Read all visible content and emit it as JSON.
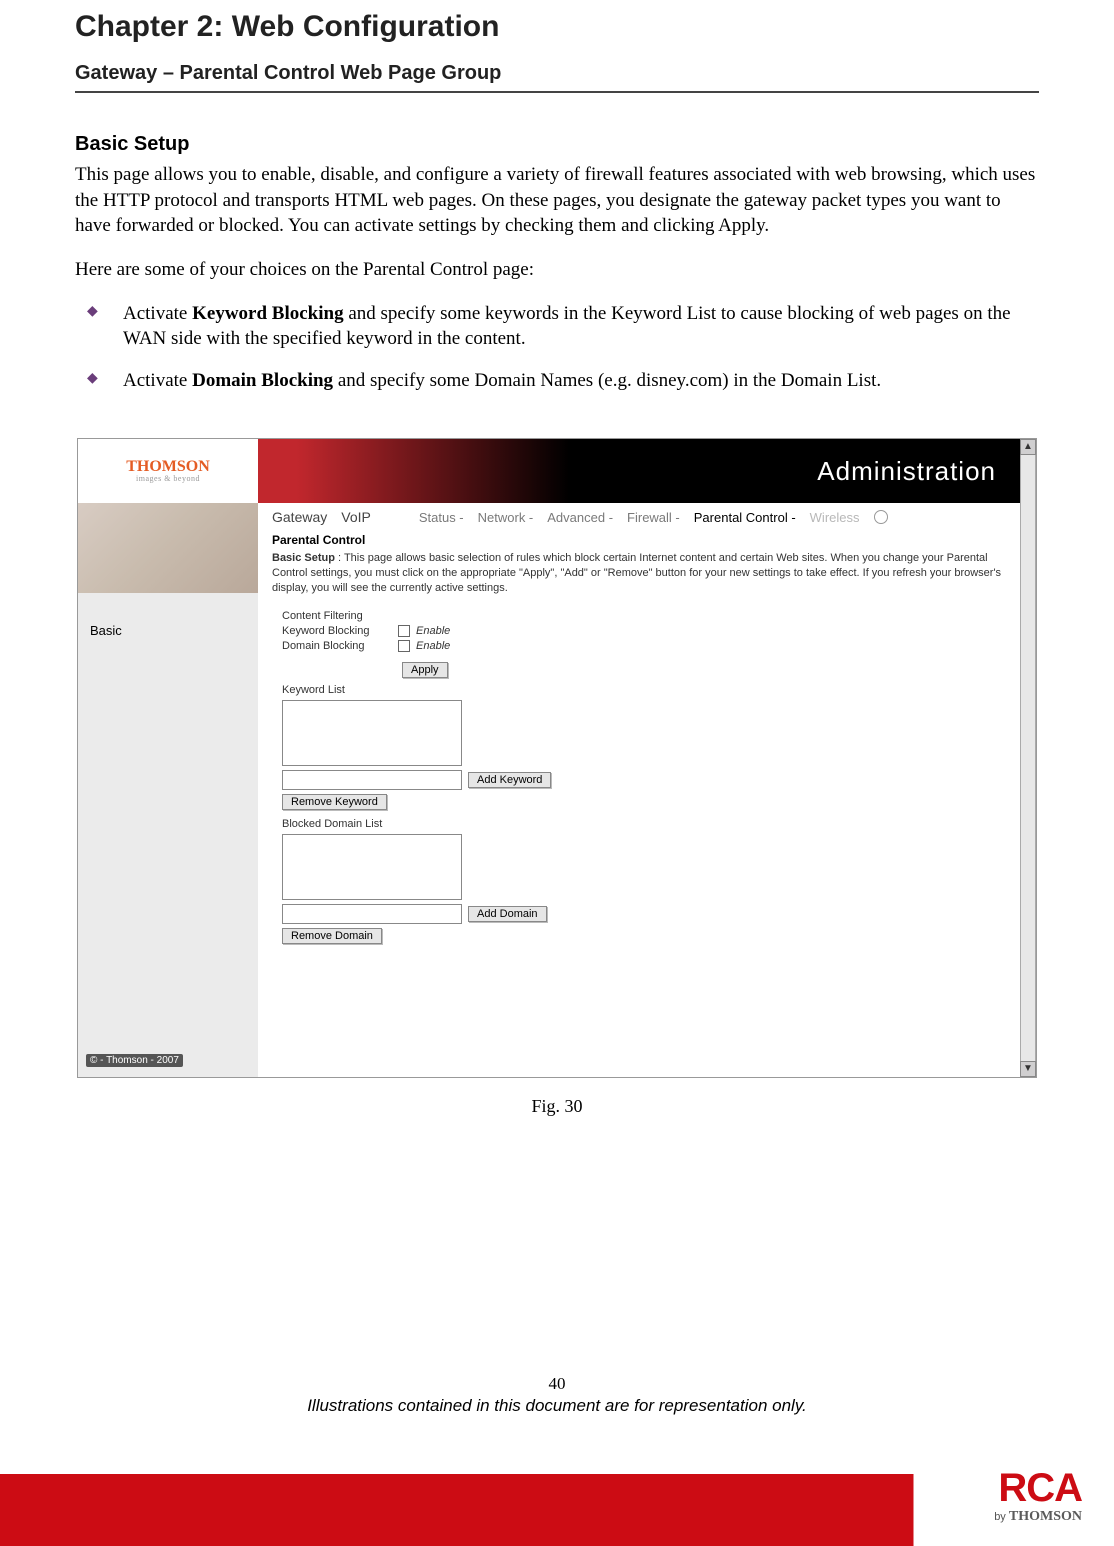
{
  "header": {
    "chapter": "Chapter 2: Web Configuration",
    "section": "Gateway – Parental Control Web Page Group"
  },
  "body": {
    "subhead": "Basic Setup",
    "p1": "This page allows you to enable, disable, and configure a variety of firewall features associated with web browsing, which uses the HTTP protocol and transports HTML web pages. On these pages, you designate the gateway packet types you want to have forwarded or blocked. You can activate settings by checking them and clicking Apply.",
    "p2": "Here are some of your choices on the Parental Control page:",
    "bullet1_pre": "Activate ",
    "bullet1_bold": "Keyword Blocking",
    "bullet1_post": " and specify some keywords in the Keyword List to cause blocking of web pages on the WAN side with the specified keyword in the content.",
    "bullet2_pre": "Activate ",
    "bullet2_bold": "Domain Blocking",
    "bullet2_post": " and specify some Domain Names (e.g. disney.com) in the Domain List."
  },
  "screenshot": {
    "brand": "THOMSON",
    "brand_tag": "images & beyond",
    "banner": "Administration",
    "sidebar_item": "Basic",
    "sidebar_copy": "© - Thomson - 2007",
    "tabs_primary": {
      "gateway": "Gateway",
      "voip": "VoIP"
    },
    "tabs_secondary": {
      "status": "Status -",
      "network": "Network -",
      "advanced": "Advanced -",
      "firewall": "Firewall -",
      "parental": "Parental Control -",
      "wireless": "Wireless"
    },
    "pc_title": "Parental Control",
    "basic_label": "Basic Setup",
    "basic_sep": " : ",
    "basic_desc": "This page allows basic selection of rules which block certain Internet content and certain Web sites. When you change your Parental Control settings, you must click on the appropriate \"Apply\", \"Add\" or \"Remove\" button for your new settings to take effect. If you refresh your browser's display, you will see the currently active settings.",
    "content_filtering": "Content Filtering",
    "keyword_blocking": "Keyword Blocking",
    "domain_blocking": "Domain Blocking",
    "enable": "Enable",
    "apply": "Apply",
    "keyword_list": "Keyword List",
    "add_keyword": "Add Keyword",
    "remove_keyword": "Remove Keyword",
    "blocked_domain_list": "Blocked Domain List",
    "add_domain": "Add Domain",
    "remove_domain": "Remove Domain"
  },
  "figure": {
    "caption": "Fig. 30"
  },
  "footer": {
    "page": "40",
    "note": "Illustrations contained in this document are for representation only.",
    "logo_main": "RCA",
    "logo_by": "by ",
    "logo_brand": "THOMSON"
  }
}
